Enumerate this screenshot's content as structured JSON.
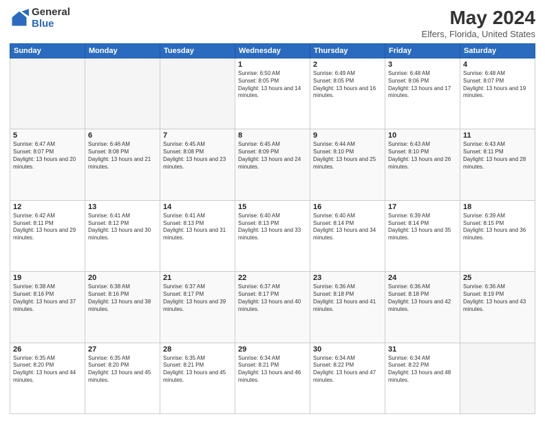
{
  "header": {
    "logo_general": "General",
    "logo_blue": "Blue",
    "month_title": "May 2024",
    "location": "Elfers, Florida, United States"
  },
  "weekdays": [
    "Sunday",
    "Monday",
    "Tuesday",
    "Wednesday",
    "Thursday",
    "Friday",
    "Saturday"
  ],
  "weeks": [
    {
      "days": [
        {
          "num": "",
          "info": ""
        },
        {
          "num": "",
          "info": ""
        },
        {
          "num": "",
          "info": ""
        },
        {
          "num": "1",
          "info": "Sunrise: 6:50 AM\nSunset: 8:05 PM\nDaylight: 13 hours and 14 minutes."
        },
        {
          "num": "2",
          "info": "Sunrise: 6:49 AM\nSunset: 8:05 PM\nDaylight: 13 hours and 16 minutes."
        },
        {
          "num": "3",
          "info": "Sunrise: 6:48 AM\nSunset: 8:06 PM\nDaylight: 13 hours and 17 minutes."
        },
        {
          "num": "4",
          "info": "Sunrise: 6:48 AM\nSunset: 8:07 PM\nDaylight: 13 hours and 19 minutes."
        }
      ]
    },
    {
      "days": [
        {
          "num": "5",
          "info": "Sunrise: 6:47 AM\nSunset: 8:07 PM\nDaylight: 13 hours and 20 minutes."
        },
        {
          "num": "6",
          "info": "Sunrise: 6:46 AM\nSunset: 8:08 PM\nDaylight: 13 hours and 21 minutes."
        },
        {
          "num": "7",
          "info": "Sunrise: 6:45 AM\nSunset: 8:08 PM\nDaylight: 13 hours and 23 minutes."
        },
        {
          "num": "8",
          "info": "Sunrise: 6:45 AM\nSunset: 8:09 PM\nDaylight: 13 hours and 24 minutes."
        },
        {
          "num": "9",
          "info": "Sunrise: 6:44 AM\nSunset: 8:10 PM\nDaylight: 13 hours and 25 minutes."
        },
        {
          "num": "10",
          "info": "Sunrise: 6:43 AM\nSunset: 8:10 PM\nDaylight: 13 hours and 26 minutes."
        },
        {
          "num": "11",
          "info": "Sunrise: 6:43 AM\nSunset: 8:11 PM\nDaylight: 13 hours and 28 minutes."
        }
      ]
    },
    {
      "days": [
        {
          "num": "12",
          "info": "Sunrise: 6:42 AM\nSunset: 8:11 PM\nDaylight: 13 hours and 29 minutes."
        },
        {
          "num": "13",
          "info": "Sunrise: 6:41 AM\nSunset: 8:12 PM\nDaylight: 13 hours and 30 minutes."
        },
        {
          "num": "14",
          "info": "Sunrise: 6:41 AM\nSunset: 8:13 PM\nDaylight: 13 hours and 31 minutes."
        },
        {
          "num": "15",
          "info": "Sunrise: 6:40 AM\nSunset: 8:13 PM\nDaylight: 13 hours and 33 minutes."
        },
        {
          "num": "16",
          "info": "Sunrise: 6:40 AM\nSunset: 8:14 PM\nDaylight: 13 hours and 34 minutes."
        },
        {
          "num": "17",
          "info": "Sunrise: 6:39 AM\nSunset: 8:14 PM\nDaylight: 13 hours and 35 minutes."
        },
        {
          "num": "18",
          "info": "Sunrise: 6:39 AM\nSunset: 8:15 PM\nDaylight: 13 hours and 36 minutes."
        }
      ]
    },
    {
      "days": [
        {
          "num": "19",
          "info": "Sunrise: 6:38 AM\nSunset: 8:16 PM\nDaylight: 13 hours and 37 minutes."
        },
        {
          "num": "20",
          "info": "Sunrise: 6:38 AM\nSunset: 8:16 PM\nDaylight: 13 hours and 38 minutes."
        },
        {
          "num": "21",
          "info": "Sunrise: 6:37 AM\nSunset: 8:17 PM\nDaylight: 13 hours and 39 minutes."
        },
        {
          "num": "22",
          "info": "Sunrise: 6:37 AM\nSunset: 8:17 PM\nDaylight: 13 hours and 40 minutes."
        },
        {
          "num": "23",
          "info": "Sunrise: 6:36 AM\nSunset: 8:18 PM\nDaylight: 13 hours and 41 minutes."
        },
        {
          "num": "24",
          "info": "Sunrise: 6:36 AM\nSunset: 8:18 PM\nDaylight: 13 hours and 42 minutes."
        },
        {
          "num": "25",
          "info": "Sunrise: 6:36 AM\nSunset: 8:19 PM\nDaylight: 13 hours and 43 minutes."
        }
      ]
    },
    {
      "days": [
        {
          "num": "26",
          "info": "Sunrise: 6:35 AM\nSunset: 8:20 PM\nDaylight: 13 hours and 44 minutes."
        },
        {
          "num": "27",
          "info": "Sunrise: 6:35 AM\nSunset: 8:20 PM\nDaylight: 13 hours and 45 minutes."
        },
        {
          "num": "28",
          "info": "Sunrise: 6:35 AM\nSunset: 8:21 PM\nDaylight: 13 hours and 45 minutes."
        },
        {
          "num": "29",
          "info": "Sunrise: 6:34 AM\nSunset: 8:21 PM\nDaylight: 13 hours and 46 minutes."
        },
        {
          "num": "30",
          "info": "Sunrise: 6:34 AM\nSunset: 8:22 PM\nDaylight: 13 hours and 47 minutes."
        },
        {
          "num": "31",
          "info": "Sunrise: 6:34 AM\nSunset: 8:22 PM\nDaylight: 13 hours and 48 minutes."
        },
        {
          "num": "",
          "info": ""
        }
      ]
    }
  ]
}
